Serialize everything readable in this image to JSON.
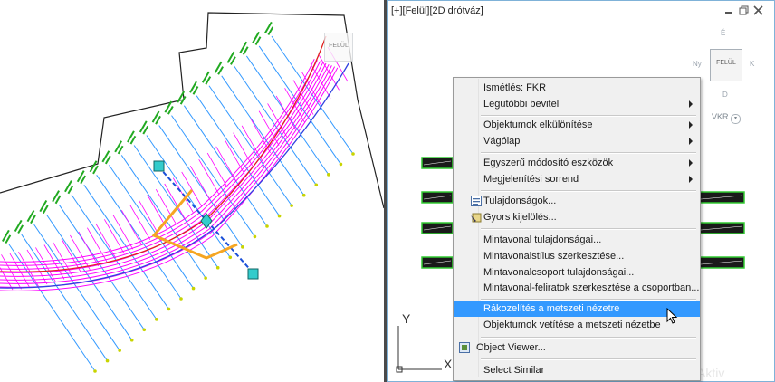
{
  "viewport": {
    "label": "[+][Felül][2D drótváz]",
    "viewcube_face": "FELÜL",
    "viewcube_face_small": "FELÜL",
    "compass_n": "É",
    "compass_s": "D",
    "compass_e": "K",
    "compass_w": "Ny",
    "ucs_menu": "VKR",
    "axis_x": "X",
    "axis_y": "Y",
    "watermark": "Aktiv"
  },
  "context_menu": {
    "items": [
      {
        "label": "Ismétlés: FKR",
        "submenu": false
      },
      {
        "label": "Legutóbbi bevitel",
        "submenu": true
      },
      {
        "label": "Objektumok elkülönítése",
        "submenu": true
      },
      {
        "label": "Vágólap",
        "submenu": true
      },
      {
        "label": "Egyszerű módosító eszközök",
        "submenu": true
      },
      {
        "label": "Megjelenítési sorrend",
        "submenu": true
      },
      {
        "label": "Tulajdonságok...",
        "submenu": false,
        "icon": "properties-icon"
      },
      {
        "label": "Gyors kijelölés...",
        "submenu": false,
        "icon": "quick-select-icon"
      },
      {
        "label": "Mintavonal tulajdonságai...",
        "submenu": false
      },
      {
        "label": "Mintavonalstílus szerkesztése...",
        "submenu": false
      },
      {
        "label": "Mintavonalcsoport tulajdonságai...",
        "submenu": false
      },
      {
        "label": "Mintavonal-feliratok szerkesztése a csoportban...",
        "submenu": false
      },
      {
        "label": "Rákozelítés a metszeti nézetre",
        "submenu": false,
        "highlighted": true
      },
      {
        "label": "Objektumok vetítése a metszeti nézetbe",
        "submenu": false
      },
      {
        "label": "Object Viewer...",
        "submenu": false,
        "icon": "object-viewer-icon"
      },
      {
        "label": "Select Similar",
        "submenu": false
      }
    ]
  },
  "colors": {
    "highlight": "#3399ff",
    "corridor": "#ff00ff",
    "sample_lines": "#3399ff",
    "labels": "#22aa22",
    "alignment": "#e02020",
    "selection": "#f5a623",
    "grip": "#33cccc"
  }
}
